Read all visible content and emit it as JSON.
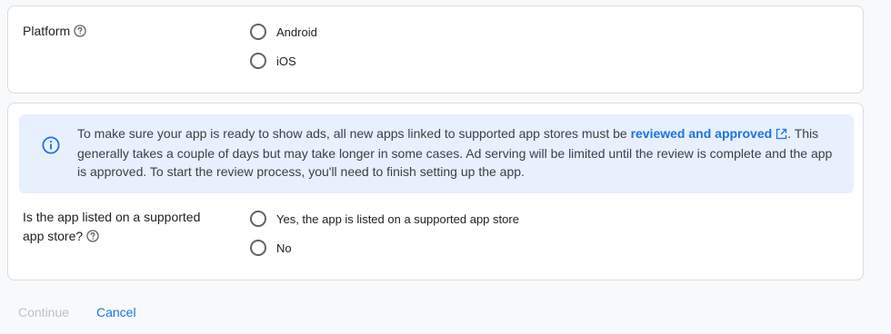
{
  "platform": {
    "label": "Platform",
    "help_icon": "help-circle-icon",
    "options": [
      {
        "label": "Android",
        "selected": false
      },
      {
        "label": "iOS",
        "selected": false
      }
    ]
  },
  "info_banner": {
    "icon": "info-icon",
    "text_before_link": "To make sure your app is ready to show ads, all new apps linked to supported app stores must be ",
    "link_text": "reviewed and approved",
    "link_icon": "external-link-icon",
    "text_after_link": ". This generally takes a couple of days but may take longer in some cases. Ad serving will be limited until the review is complete and the app is approved. To start the review process, you'll need to finish setting up the app."
  },
  "store_listing": {
    "label_line1": "Is the app listed on a supported",
    "label_line2": "app store?",
    "help_icon": "help-circle-icon",
    "options": [
      {
        "label": "Yes, the app is listed on a supported app store",
        "selected": false
      },
      {
        "label": "No",
        "selected": false
      }
    ]
  },
  "footer": {
    "continue_label": "Continue",
    "cancel_label": "Cancel"
  },
  "colors": {
    "link": "#1a73e8",
    "banner_bg": "#e8f0fe",
    "disabled_text": "#bdc1c6",
    "radio_border": "#5f6368"
  }
}
